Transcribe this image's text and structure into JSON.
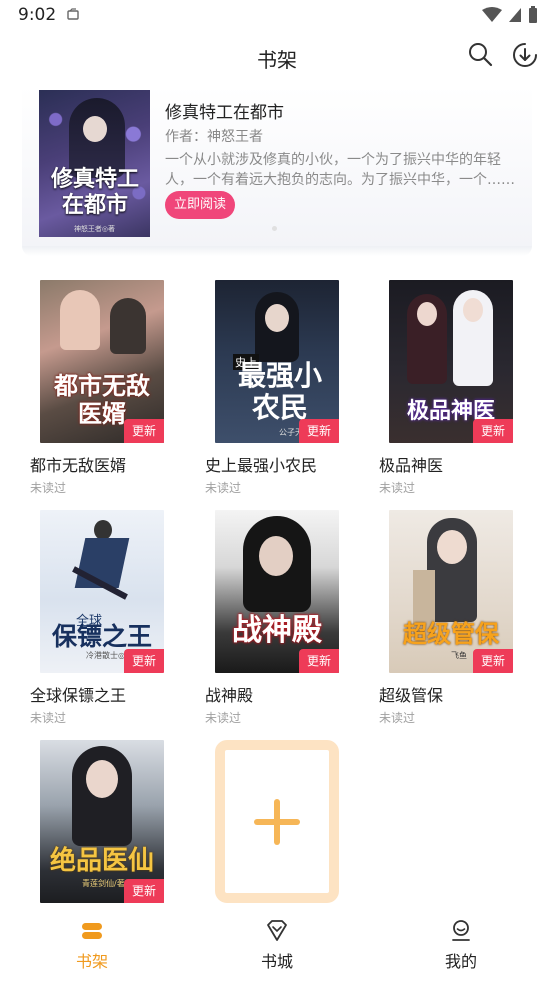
{
  "status_bar": {
    "time": "9:02"
  },
  "header": {
    "title": "书架"
  },
  "featured": {
    "title": "修真特工在都市",
    "author": "作者：神怒王者",
    "description": "一个从小就涉及修真的小伙，一个为了振兴中华的年轻人，一个有着远大抱负的志向。为了振兴中华，一个……",
    "read_button": "立即阅读",
    "cover_text": "修真特工在都市",
    "cover_credit": "神怒王者◎著"
  },
  "books": [
    {
      "title": "都市无敌医婿",
      "status": "未读过",
      "badge": "更新",
      "cover_text": "都市无敌医婿"
    },
    {
      "title": "史上最强小农民",
      "status": "未读过",
      "badge": "更新",
      "cover_text": "最强小农民",
      "cover_small": "史上",
      "cover_credit": "公子无花"
    },
    {
      "title": "极品神医",
      "status": "未读过",
      "badge": "更新",
      "cover_text": "极品神医"
    },
    {
      "title": "全球保镖之王",
      "status": "未读过",
      "badge": "更新",
      "cover_text": "保镖之王",
      "cover_small": "全球",
      "cover_credit": "冷港散士◎著"
    },
    {
      "title": "战神殿",
      "status": "未读过",
      "badge": "更新",
      "cover_text": "战神殿"
    },
    {
      "title": "超级管保",
      "status": "未读过",
      "badge": "更新",
      "cover_text": "超级管保",
      "cover_credit": "飞鱼"
    },
    {
      "title": "绝品医仙",
      "status": "",
      "badge": "更新",
      "cover_text": "绝品医仙",
      "cover_credit": "青莲剑仙/著"
    }
  ],
  "nav": [
    {
      "label": "书架",
      "icon": "bookshelf-icon",
      "active": true
    },
    {
      "label": "书城",
      "icon": "bookstore-icon",
      "active": false
    },
    {
      "label": "我的",
      "icon": "profile-icon",
      "active": false
    }
  ],
  "colors": {
    "accent": "#f09a1e",
    "badge": "#ee3b58",
    "read_button": "#f0467a",
    "add_tile": "#f6b657"
  }
}
